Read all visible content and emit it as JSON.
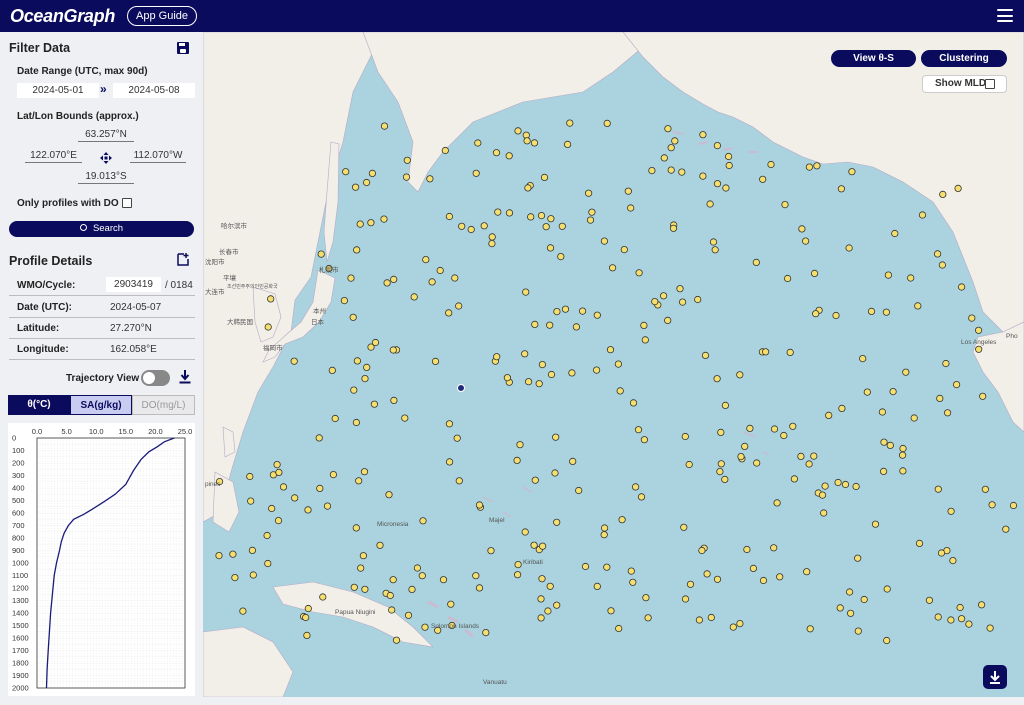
{
  "header": {
    "logo": "OceanGraph",
    "app_guide_label": "App Guide"
  },
  "filter": {
    "title": "Filter Data",
    "date_range_label": "Date Range (UTC, max 90d)",
    "date_start": "2024-05-01",
    "date_end": "2024-05-08",
    "date_arrow": "»",
    "bounds_label": "Lat/Lon Bounds (approx.)",
    "north": "63.257°N",
    "west": "122.070°E",
    "east": "112.070°W",
    "south": "19.013°S",
    "do_only_label": "Only profiles with DO :",
    "search_label": "Search"
  },
  "details": {
    "title": "Profile Details",
    "wmo_label": "WMO/Cycle:",
    "wmo_value": "2903419",
    "cycle_value": "/ 0184",
    "date_label": "Date (UTC):",
    "date_value": "2024-05-07",
    "lat_label": "Latitude:",
    "lat_value": "27.270°N",
    "lon_label": "Longitude:",
    "lon_value": "162.058°E",
    "trajectory_label": "Trajectory View"
  },
  "variable_tabs": {
    "theta": "θ(°C)",
    "sa": "SA(g/kg)",
    "do": "DO(mg/L)"
  },
  "chart_data": {
    "type": "line",
    "title": "",
    "xlabel": "",
    "ylabel": "",
    "x_ticks": [
      "0.0",
      "5.0",
      "10.0",
      "15.0",
      "20.0",
      "25.0"
    ],
    "y_ticks": [
      "0",
      "100",
      "200",
      "300",
      "400",
      "500",
      "600",
      "700",
      "800",
      "900",
      "1000",
      "1100",
      "1200",
      "1300",
      "1400",
      "1500",
      "1600",
      "1700",
      "1800",
      "1900",
      "2000"
    ],
    "xlim": [
      0,
      25
    ],
    "ylim": [
      0,
      2000
    ],
    "y_inverted": true,
    "grid": true,
    "series": [
      {
        "x": [
          23.2,
          21.5,
          20.3,
          18.9,
          17.6,
          16.3,
          15.0,
          13.2,
          11.3,
          9.3,
          7.9,
          6.2,
          5.3,
          4.6,
          4.1,
          3.8,
          3.3,
          2.9,
          2.6,
          2.3,
          2.1,
          1.9,
          1.7,
          1.6
        ],
        "y": [
          0,
          30,
          70,
          110,
          170,
          260,
          370,
          450,
          510,
          570,
          610,
          650,
          700,
          760,
          830,
          900,
          1000,
          1100,
          1250,
          1400,
          1550,
          1700,
          1850,
          2000
        ]
      }
    ]
  },
  "map": {
    "view_ts_label": "View θ-S",
    "clustering_label": "Clustering",
    "show_mld_label": "Show MLD",
    "labels": [
      {
        "text": "札幌市"
      },
      {
        "text": "日本"
      },
      {
        "text": "本州"
      },
      {
        "text": "福岡市"
      },
      {
        "text": "哈尔滨市"
      },
      {
        "text": "长春市"
      },
      {
        "text": "沈阳市"
      },
      {
        "text": "大连市"
      },
      {
        "text": "平壤"
      },
      {
        "text": "조선민주주의인민공화국"
      },
      {
        "text": "大韩民国"
      },
      {
        "text": "Micronesia"
      },
      {
        "text": "Majel"
      },
      {
        "text": "Kiribati"
      },
      {
        "text": "Papua Niugini"
      },
      {
        "text": "Solomon Islands"
      },
      {
        "text": "Vanuatu"
      },
      {
        "text": "Los Angeles"
      },
      {
        "text": "Pho"
      },
      {
        "text": "pines"
      }
    ],
    "float_count": 360,
    "selected_color": "#1e2a7a",
    "float_color": "#f5df6e"
  }
}
